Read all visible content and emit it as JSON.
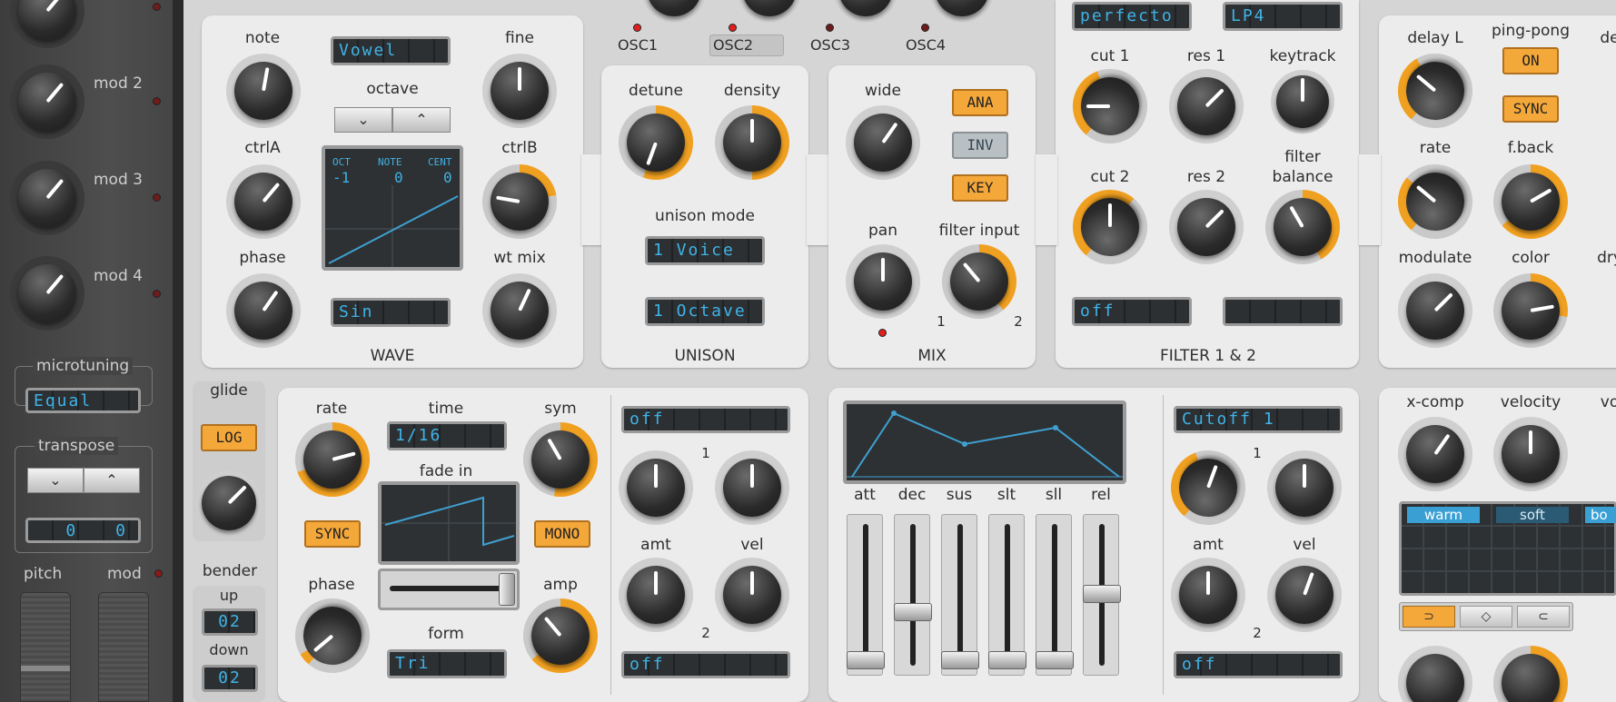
{
  "sidebar": {
    "mods": [
      "mod 2",
      "mod 3",
      "mod 4"
    ],
    "microtuning_label": "microtuning",
    "microtuning_value": "Equal",
    "transpose_label": "transpose",
    "transpose_down": "⌄",
    "transpose_up": "⌃",
    "transpose_values": [
      "0",
      "0"
    ],
    "pitch_label": "pitch",
    "mod_label": "mod"
  },
  "osc_tabs": [
    "OSC1",
    "OSC2",
    "OSC3",
    "OSC4"
  ],
  "oscillator": {
    "note": "note",
    "fine": "fine",
    "wave_select": "Vowel",
    "octave": "octave",
    "octave_down": "⌄",
    "octave_up": "⌃",
    "ctrlA": "ctrlA",
    "ctrlB": "ctrlB",
    "screen_hdr": [
      "OCT",
      "NOTE",
      "CENT"
    ],
    "screen_vals": [
      "-1",
      "0",
      "0"
    ],
    "phase": "phase",
    "wt_mix": "wt mix",
    "wave_value": "Sin",
    "section": "WAVE"
  },
  "unison": {
    "detune": "detune",
    "density": "density",
    "mode_label": "unison mode",
    "voices": "1 Voice",
    "range": "1 Octave",
    "section": "UNISON"
  },
  "mix": {
    "wide": "wide",
    "ana": "ANA",
    "inv": "INV",
    "key": "KEY",
    "pan": "pan",
    "filter_input": "filter input",
    "fi_1": "1",
    "fi_2": "2",
    "section": "MIX"
  },
  "filter": {
    "type": "perfecto",
    "mode": "LP4",
    "cut1": "cut 1",
    "res1": "res 1",
    "keytrack": "keytrack",
    "cut2": "cut 2",
    "res2": "res 2",
    "balance": "filter\nbalance",
    "mod_value": "off",
    "mod2_value": "",
    "section": "FILTER 1 & 2"
  },
  "delay": {
    "delay_l": "delay L",
    "ping_pong": "ping-pong",
    "de_partial": "de",
    "on": "ON",
    "sync": "SYNC",
    "rate": "rate",
    "fback": "f.back",
    "modulate": "modulate",
    "color": "color",
    "dry_partial": "dry"
  },
  "glide": {
    "label": "glide",
    "mode": "LOG"
  },
  "bender": {
    "label": "bender",
    "up": "up",
    "up_val": "02",
    "down": "down",
    "down_val": "02"
  },
  "lfo": {
    "rate": "rate",
    "time": "time",
    "time_val": "1/16",
    "sym": "sym",
    "sync": "SYNC",
    "fade_in": "fade in",
    "mono": "MONO",
    "phase": "phase",
    "amp": "amp",
    "form": "form",
    "form_val": "Tri",
    "dest1": "off",
    "dest2": "off",
    "n1": "1",
    "n2": "2",
    "amt": "amt",
    "vel": "vel"
  },
  "env": {
    "labels": [
      "att",
      "dec",
      "sus",
      "slt",
      "sll",
      "rel"
    ],
    "slider_levels": [
      0.0,
      0.38,
      0.0,
      0.0,
      0.0,
      0.52
    ],
    "dest1": "Cutoff 1",
    "dest2": "off",
    "n1": "1",
    "n2": "2",
    "amt": "amt",
    "vel": "vel"
  },
  "right": {
    "xcomp": "x-comp",
    "velocity": "velocity",
    "vo_partial": "vo",
    "tabs": [
      "warm",
      "soft",
      "bo"
    ]
  }
}
